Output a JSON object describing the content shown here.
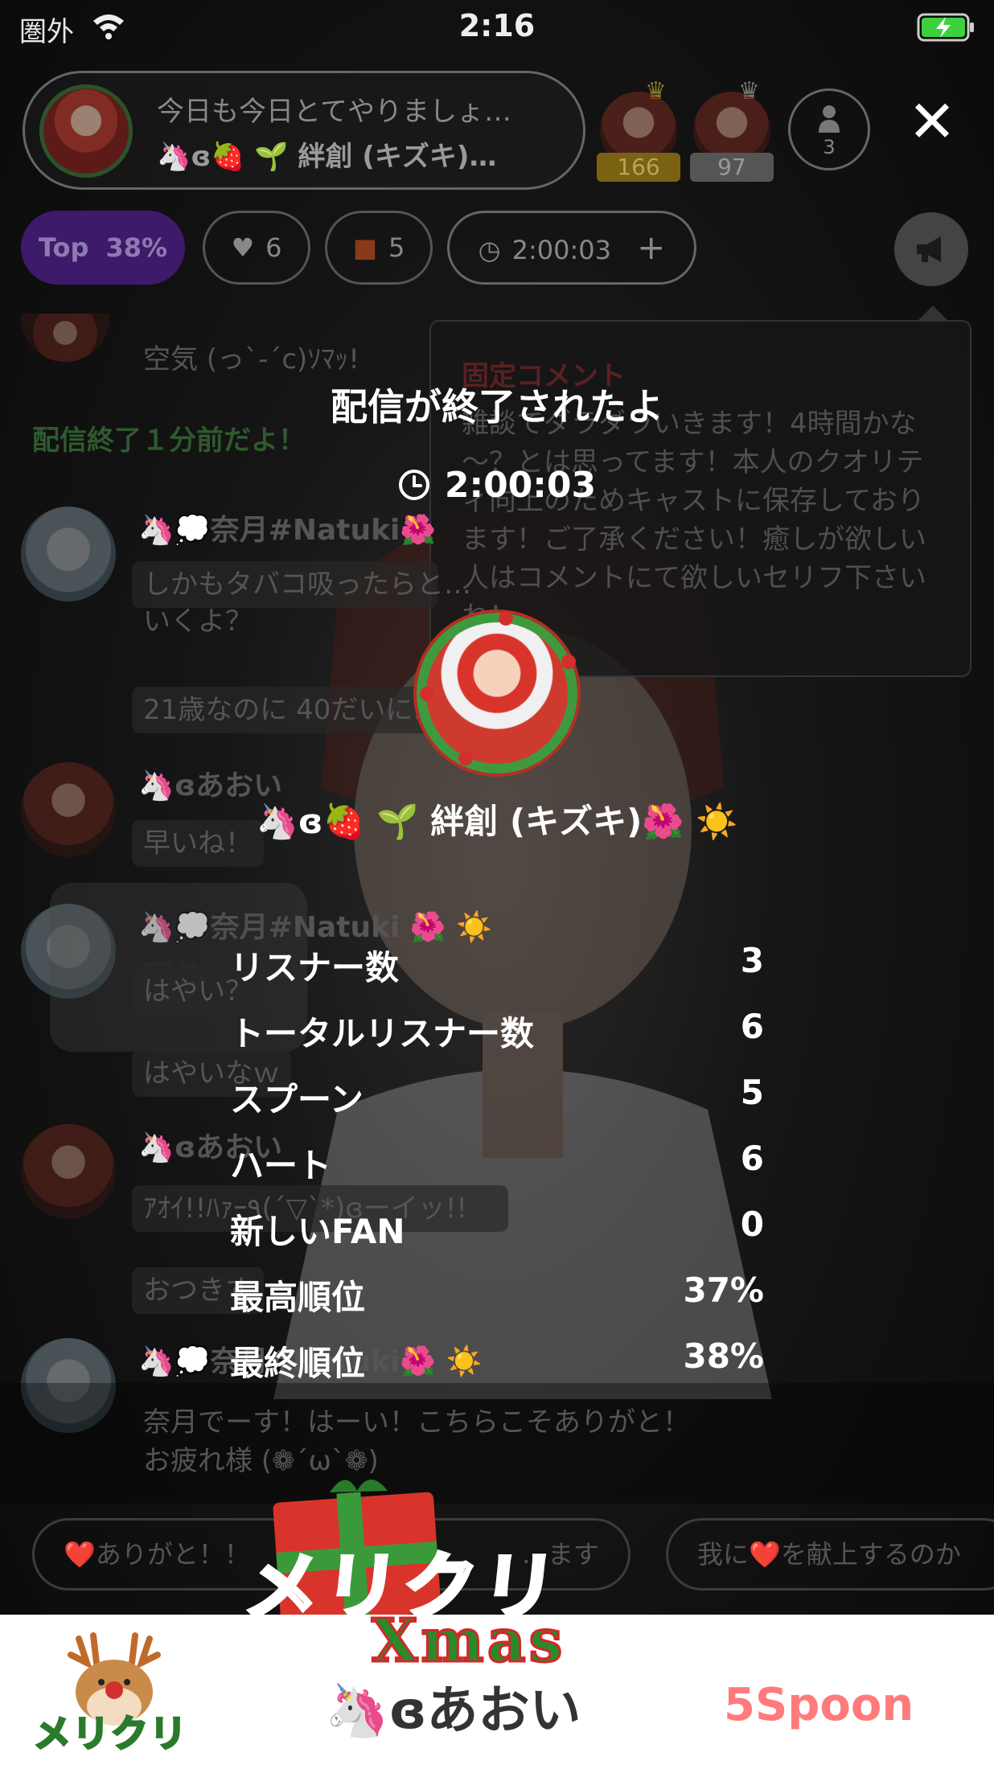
{
  "status_bar": {
    "carrier": "圏外",
    "time": "2:16"
  },
  "host": {
    "comment": "今日も今日とてやりましょ…",
    "name": "🦄ɞ🍓 🌱 絆創 (キズキ)…"
  },
  "top_ranks": [
    {
      "count": "166"
    },
    {
      "count": "97"
    }
  ],
  "listener_count": "3",
  "chips": {
    "top_label": "Top",
    "top_percent": "38%",
    "hearts": "6",
    "gifts": "5",
    "time": "2:00:03",
    "add": "+"
  },
  "pinned": {
    "title": "固定コメント",
    "body": "雑談でダラダラいきます！4時間かな～？とは思ってます！本人のクオリティ向上のためキャストに保存しております！ご了承ください！癒しが欲しい人はコメントにて欲しいセリフ下さいね！"
  },
  "chat": {
    "m0_text": "空気 (っ`-´c)ｿﾏｯ!",
    "system_notice": "配信終了１分前だよ！",
    "m1_name": "🦄💭奈月#Natuki🌺",
    "m1_text1": "しかもタバコ吸ったらと…",
    "m1_text2": "いくよ？",
    "m1_text3": "21歳なのに 40だいに…いな",
    "m2_name": "🦄ɞあおい",
    "m2_text": "早いね！",
    "m3_name": "🦄💭奈月#Natuki 🌺 ☀️",
    "m3_text1": "はやい？",
    "m3_text2": "はやいなｗ",
    "m4_name": "🦄ɞあおい",
    "m4_text1": "ｱｵｲ!!ﾊｧｰ٩(´▽`*)ɞーイッ!!",
    "m4_text2": "おつきす",
    "m5_name": "🦄💭奈月#Natuki🌺 ☀️",
    "m5_text1": "奈月でーす！はーい！こちらこそありがと！",
    "m5_text2": "お疲れ様 (❁´ω`❁)",
    "dim_label": "配信"
  },
  "quick_replies": [
    "❤️ありがと！！",
    "…ます",
    "我に❤️を献上するのか"
  ],
  "end_overlay": {
    "title": "配信が終了されたよ",
    "duration": "2:00:03",
    "dj_name": "🦄ɞ🍓 🌱 絆創 (キズキ)🌺 ☀️",
    "stats": [
      {
        "label": "リスナー数",
        "value": "3"
      },
      {
        "label": "トータルリスナー数",
        "value": "6"
      },
      {
        "label": "スプーン",
        "value": "5"
      },
      {
        "label": "ハート",
        "value": "6"
      },
      {
        "label": "新しいFAN",
        "value": "0"
      },
      {
        "label": "最高順位",
        "value": "37%"
      },
      {
        "label": "最終順位",
        "value": "38%"
      }
    ]
  },
  "xmas_banner": {
    "big_text": "メリクリ",
    "small_text": "メリクリ",
    "xmas": "Xmas",
    "gifter": "🦄ɞあおい",
    "spoons": "5Spoon"
  },
  "colors": {
    "accent_purple": "#3e1a6b",
    "xmas_red": "#d6262a",
    "xmas_green": "#2a8a2a",
    "spoon_pink": "#ff7b7b"
  }
}
